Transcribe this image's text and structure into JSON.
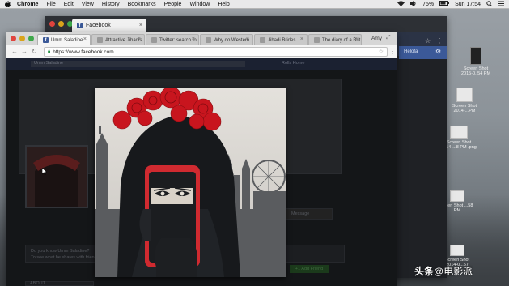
{
  "menubar": {
    "app_name": "Chrome",
    "items": [
      "File",
      "Edit",
      "View",
      "History",
      "Bookmarks",
      "People",
      "Window",
      "Help"
    ],
    "battery": "75%",
    "clock": "Sun 17:54"
  },
  "back_window": {
    "tab_title": "Facebook",
    "profile_label": "Helofa"
  },
  "front_window": {
    "tabs": [
      {
        "title": "Umm Saladine",
        "active": true
      },
      {
        "title": "Attractive Jihadis",
        "active": false
      },
      {
        "title": "Twitter: search fo",
        "active": false
      },
      {
        "title": "Why do Western",
        "active": false
      },
      {
        "title": "Jihadi Brides",
        "active": false
      },
      {
        "title": "The diary of a Brit",
        "active": false
      }
    ],
    "tab_user": "Amy",
    "url": "https://www.facebook.com"
  },
  "page": {
    "search_placeholder": "Umm Saladine",
    "header_links": "Rolls   Home",
    "about_label": "Do you know Umm Saladine?",
    "about_sub": "To see what he shares with friends...",
    "add_friend": "+1 Add Friend",
    "message": "Message",
    "intro": "ABOUT",
    "overview": "Intro"
  },
  "desktop_icons": [
    {
      "label": "Screen Shot 2015-0..54 PM"
    },
    {
      "label": "Screen Shot 2014-...PM"
    },
    {
      "label": "Screen Shot 2014-...8 PM .png"
    },
    {
      "label": "...een Shot ...58 PM"
    },
    {
      "label": "Screen Shot 2014-0...57"
    }
  ],
  "watermark": {
    "brand": "头条",
    "handle": "@电影派"
  },
  "colors": {
    "facebook_blue": "#3b5998",
    "flower_red": "#c8151e",
    "phone_case": "#d02a30"
  },
  "icons": [
    "apple-icon",
    "wifi-icon",
    "volume-icon",
    "battery-icon",
    "search-icon",
    "notification-icon",
    "close-icon",
    "back-icon",
    "forward-icon",
    "reload-icon",
    "lock-icon",
    "star-icon",
    "menu-icon",
    "gear-icon",
    "cursor-icon"
  ]
}
